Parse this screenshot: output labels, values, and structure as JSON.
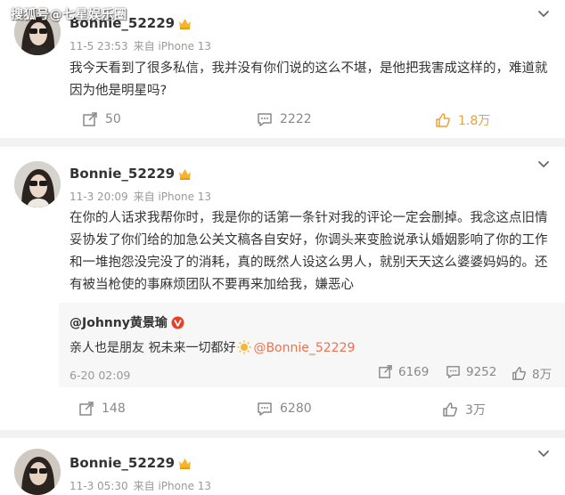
{
  "watermark": "搜狐号@七星娱乐圈",
  "posts": [
    {
      "username": "Bonnie_52229",
      "time": "11-5 23:53",
      "source": "来自 iPhone 13",
      "text": "我今天看到了很多私信，我并没有你们说的这么不堪，是他把我害成这样的，难道就因为他是明星吗?",
      "reposts": "50",
      "comments": "2222",
      "likes": "1.8万"
    },
    {
      "username": "Bonnie_52229",
      "time": "11-3 20:09",
      "source": "来自 iPhone 13",
      "text": "在你的人话求我帮你时，我是你的话第一条针对我的评论一定会删掉。我念这点旧情妥协发了你们给的加急公关文稿各自安好，你调头来变脸说承认婚姻影响了你的工作和一堆抱怨没完没了的消耗，真的既然人设这么男人，就别天天这么婆婆妈妈的。还有被当枪使的事麻烦团队不要再来加给我，嫌恶心",
      "repost": {
        "user": "@Johnny黄景瑜",
        "text_before": "亲人也是朋友 祝未来一切都好",
        "mention": "@Bonnie_52229",
        "time": "6-20 02:09",
        "reposts": "6169",
        "comments": "9252",
        "likes": "8万"
      },
      "reposts": "148",
      "comments": "6280",
      "likes": "3万"
    },
    {
      "username": "Bonnie_52229",
      "time": "11-3 05:30",
      "source": "来自 iPhone 13"
    }
  ],
  "colors": {
    "accent_like": "#e8a23a",
    "mention": "#eb7350",
    "verified": "#e0432a"
  }
}
